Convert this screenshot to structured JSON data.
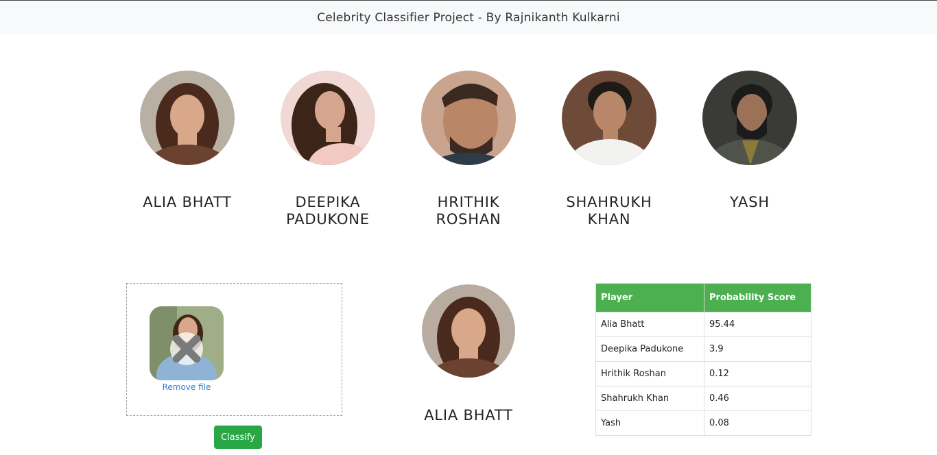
{
  "navbar": {
    "title": "Celebrity Classifier Project - By Rajnikanth Kulkarni"
  },
  "celebrities": [
    {
      "name": "ALIA BHATT",
      "icon": "alia-bhatt-photo",
      "skin": "#d9a789",
      "hair": "#4a2a1c",
      "bg": "#b9b0a4"
    },
    {
      "name": "DEEPIKA PADUKONE",
      "icon": "deepika-padukone-photo",
      "skin": "#d6a58d",
      "hair": "#3c2418",
      "bg": "#f0d9d4"
    },
    {
      "name": "HRITHIK ROSHAN",
      "icon": "hrithik-roshan-photo",
      "skin": "#b98668",
      "hair": "#3a2a22",
      "bg": "#c9a590"
    },
    {
      "name": "SHAHRUKH KHAN",
      "icon": "shahrukh-khan-photo",
      "skin": "#b88668",
      "hair": "#1e1a18",
      "bg": "#6e4a38"
    },
    {
      "name": "YASH",
      "icon": "yash-photo",
      "skin": "#9b7258",
      "hair": "#1b1b1b",
      "bg": "#3a3a36"
    }
  ],
  "upload": {
    "remove_label": "Remove file",
    "thumb_icon": "uploaded-photo-thumbnail",
    "remove_icon": "close-icon"
  },
  "classify_button": "Classify",
  "result": {
    "name": "ALIA BHATT",
    "icon": "result-photo"
  },
  "table": {
    "headers": [
      "Player",
      "Probability Score"
    ],
    "rows": [
      [
        "Alia Bhatt",
        "95.44"
      ],
      [
        "Deepika Padukone",
        "3.9"
      ],
      [
        "Hrithik Roshan",
        "0.12"
      ],
      [
        "Shahrukh Khan",
        "0.46"
      ],
      [
        "Yash",
        "0.08"
      ]
    ]
  },
  "colors": {
    "header_green": "#4caf50",
    "button_green": "#28a745",
    "link_blue": "#2f7fd6"
  }
}
